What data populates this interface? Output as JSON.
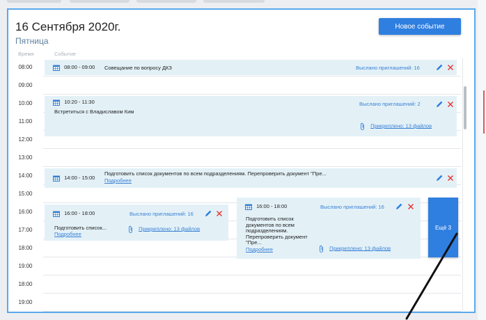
{
  "header": {
    "date_title": "16 Сентября 2020г.",
    "weekday": "Пятница",
    "new_event_button": "Новое событие",
    "col_time": "Время",
    "col_event": "Событие"
  },
  "time_rows": [
    "08:00",
    "09:00",
    "10:00",
    "11:00",
    "12:00",
    "13:00",
    "14:00",
    "15:00",
    "16:00",
    "17:00",
    "18:00",
    "19:00",
    "18:00",
    "19:00"
  ],
  "events": {
    "e1": {
      "time": "08:00 - 09:00",
      "title": "Совещание по вопросу ДКЗ",
      "invites": "Выслано приглашений: 16"
    },
    "e2": {
      "time": "10:20 - 11:30",
      "title": "Встретиться с Владиславом Ким",
      "invites": "Выслано приглашений: 2",
      "attached": "Прикреплено: 13 файлов"
    },
    "e3": {
      "time": "14:00 - 15:00",
      "title": "Подготовить список документов по всем подразделениям. Перепроверить документ \"Пре...",
      "more": "Подробнее"
    },
    "e4": {
      "time": "16:00 - 18:00",
      "invites": "Выслано приглашений: 16",
      "title": "Подготовить список...",
      "more": "Подробнее",
      "attached": "Прикреплено: 13 файлов"
    },
    "e5": {
      "time": "16:00 - 18:00",
      "invites": "Выслано приглашений: 16",
      "title_lines": [
        "Подготовить список",
        "документов по всем",
        "подразделениям.",
        "Перепроверить документ",
        "\"Пре..."
      ],
      "more": "Подробнее",
      "attached": "Прикреплено: 13 файлов"
    }
  },
  "more_button": "Ещё 3",
  "colors": {
    "accent": "#2f7fe0",
    "event_bg": "#e3f1f7",
    "delete": "#e53935",
    "link": "#3a7fd5"
  }
}
